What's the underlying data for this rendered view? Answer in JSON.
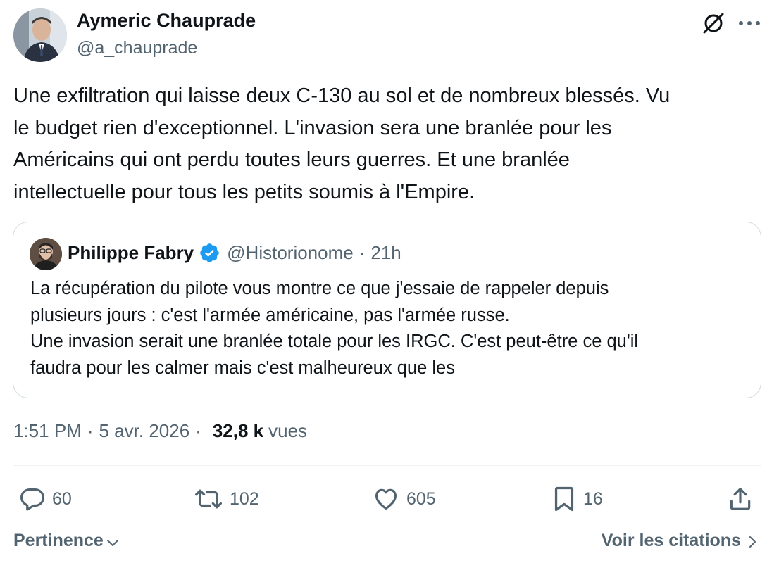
{
  "author": {
    "name": "Aymeric Chauprade",
    "handle": "@a_chauprade"
  },
  "tweet": {
    "text": "Une exfiltration qui laisse deux C-130 au sol et de nombreux blessés. Vu\nle budget rien d'exceptionnel. L'invasion sera une branlée pour les\nAméricains qui ont perdu toutes leurs guerres. Et une branlée\nintellectuelle pour tous les petits soumis à l'Empire."
  },
  "quote": {
    "name": "Philippe Fabry",
    "handle": "@Historionome",
    "separator": "·",
    "time": "21h",
    "text": "La récupération du pilote vous montre ce que j'essaie de rappeler depuis\nplusieurs jours : c'est l'armée américaine,  pas l'armée russe.\nUne invasion serait une branlée totale pour les IRGC. C'est peut-être ce qu'il\nfaudra pour les calmer mais c'est malheureux que les"
  },
  "meta": {
    "time": "1:51 PM",
    "separator": "·",
    "date": "5 avr. 2026",
    "views_count": "32,8 k",
    "views_label": "vues"
  },
  "actions": {
    "replies": "60",
    "retweets": "102",
    "likes": "605",
    "bookmarks": "16"
  },
  "footer": {
    "sort_label": "Pertinence",
    "quotes_label": "Voir les citations"
  },
  "colors": {
    "text": "#0f1419",
    "secondary": "#536471",
    "verified": "#1d9bf0",
    "border": "#cfd9de"
  },
  "icons": [
    "grok-icon",
    "more-icon",
    "verified-badge-icon",
    "reply-icon",
    "retweet-icon",
    "like-icon",
    "bookmark-icon",
    "share-icon",
    "chevron-down-icon",
    "chevron-right-icon"
  ]
}
